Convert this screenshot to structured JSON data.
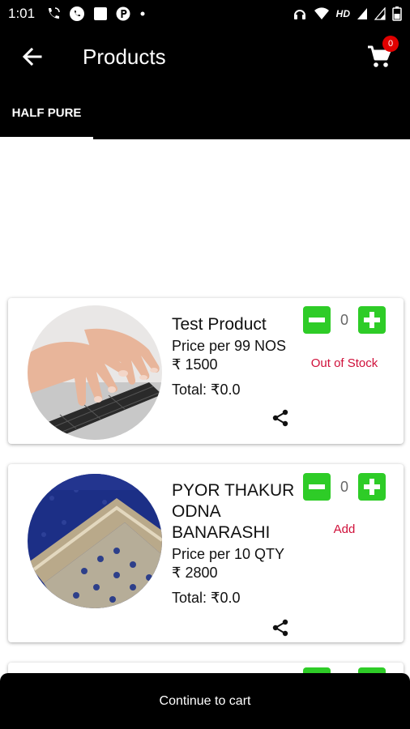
{
  "status_bar": {
    "time": "1:01",
    "network_label": "HD",
    "left_icons": [
      "wifi-call-icon",
      "whatsapp-icon",
      "image-notification-icon",
      "paytm-icon",
      "dot-icon"
    ],
    "right_icons": [
      "headset-icon",
      "wifi-icon",
      "signal-icon",
      "signal-icon",
      "battery-icon"
    ]
  },
  "toolbar": {
    "title": "Products",
    "cart_count": "0"
  },
  "tabs": [
    {
      "label": "HALF PURE",
      "active": true
    }
  ],
  "products": [
    {
      "name": "Test Product",
      "price_label": "Price per 99 NOS",
      "amount": "₹ 1500",
      "total_label": "Total:",
      "total_value": "₹0.0",
      "quantity": "0",
      "status": "Out of Stock",
      "image": "keyboard-typing-hands"
    },
    {
      "name": "PYOR THAKUR ODNA BANARASHI",
      "price_label": "Price per 10 QTY",
      "amount": "₹ 2800",
      "total_label": "Total:",
      "total_value": "₹0.0",
      "quantity": "0",
      "status": "Add",
      "image": "blue-banarasi-odhni-fabric"
    }
  ],
  "footer": {
    "continue_label": "Continue to cart"
  },
  "colors": {
    "header_bg": "#000000",
    "accent_green": "#2ecc27",
    "status_red": "#d0103a",
    "badge_red": "#e00000"
  }
}
